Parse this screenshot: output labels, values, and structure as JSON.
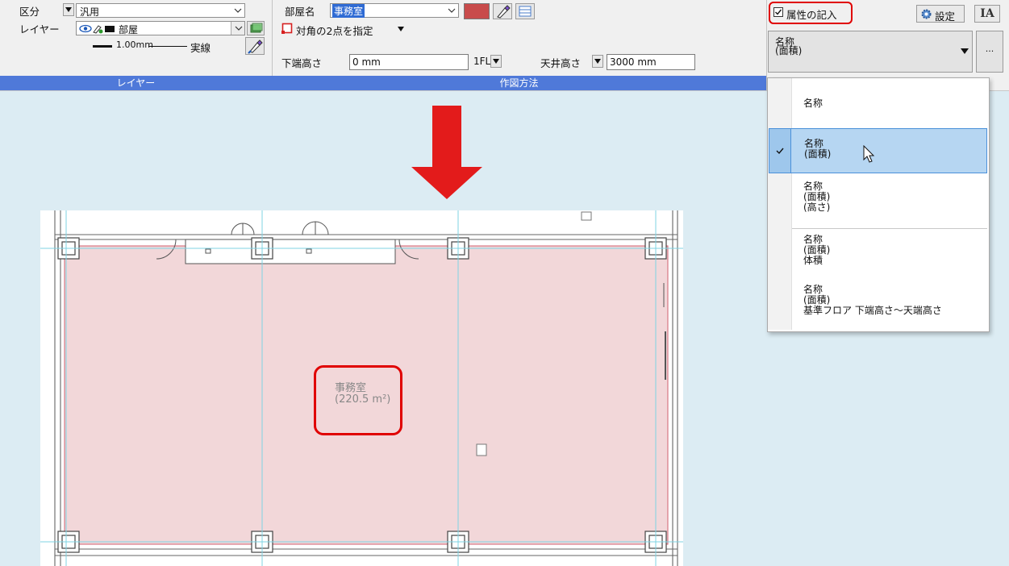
{
  "ribbon": {
    "kubun_label": "区分",
    "kubun_value": "汎用",
    "layer_label": "レイヤー",
    "layer_value": "部屋",
    "line_width": "1.00mm",
    "line_type": "実線",
    "layer_group_label": "レイヤー",
    "room_name_label": "部屋名",
    "room_name_value": "事務室",
    "diag_label": "対角の2点を指定",
    "bottom_height_label": "下端高さ",
    "bottom_height_value": "0 mm",
    "floor_value": "1FL",
    "ceiling_height_label": "天井高さ",
    "ceiling_height_value": "3000 mm",
    "method_group_label": "作図方法",
    "attr_checkbox_label": "属性の記入",
    "settings_label": "設定",
    "ia_label": "IA",
    "format_select": "名称\n(面積)",
    "more_label": "..."
  },
  "dropdown": {
    "items": [
      {
        "text": "名称",
        "selected": false
      },
      {
        "text": "名称\n(面積)",
        "selected": true
      },
      {
        "text": "名称\n(面積)\n(高さ)",
        "selected": false
      },
      {
        "text": "名称\n(面積)\n体積",
        "selected": false
      },
      {
        "text": "名称\n(面積)\n基準フロア 下端高さ～天端高さ",
        "selected": false
      }
    ]
  },
  "drawing": {
    "room_label": "事務室",
    "room_area": "(220.5 m²)"
  },
  "colors": {
    "ribbon_group_bar": "#4f79d9",
    "room_fill": "#f2d7d9",
    "room_border": "#d06070",
    "highlight_red": "#e00000",
    "arrow_red": "#e31b1b",
    "room_color_swatch": "#c84b4b",
    "guide_cyan": "#7fd3e3"
  },
  "icons": {
    "down_arrow": "big-red-down-arrow-icon",
    "eyedropper": "eyedropper-icon",
    "gear": "gear-icon",
    "check": "check-icon",
    "cursor": "mouse-cursor-icon"
  }
}
